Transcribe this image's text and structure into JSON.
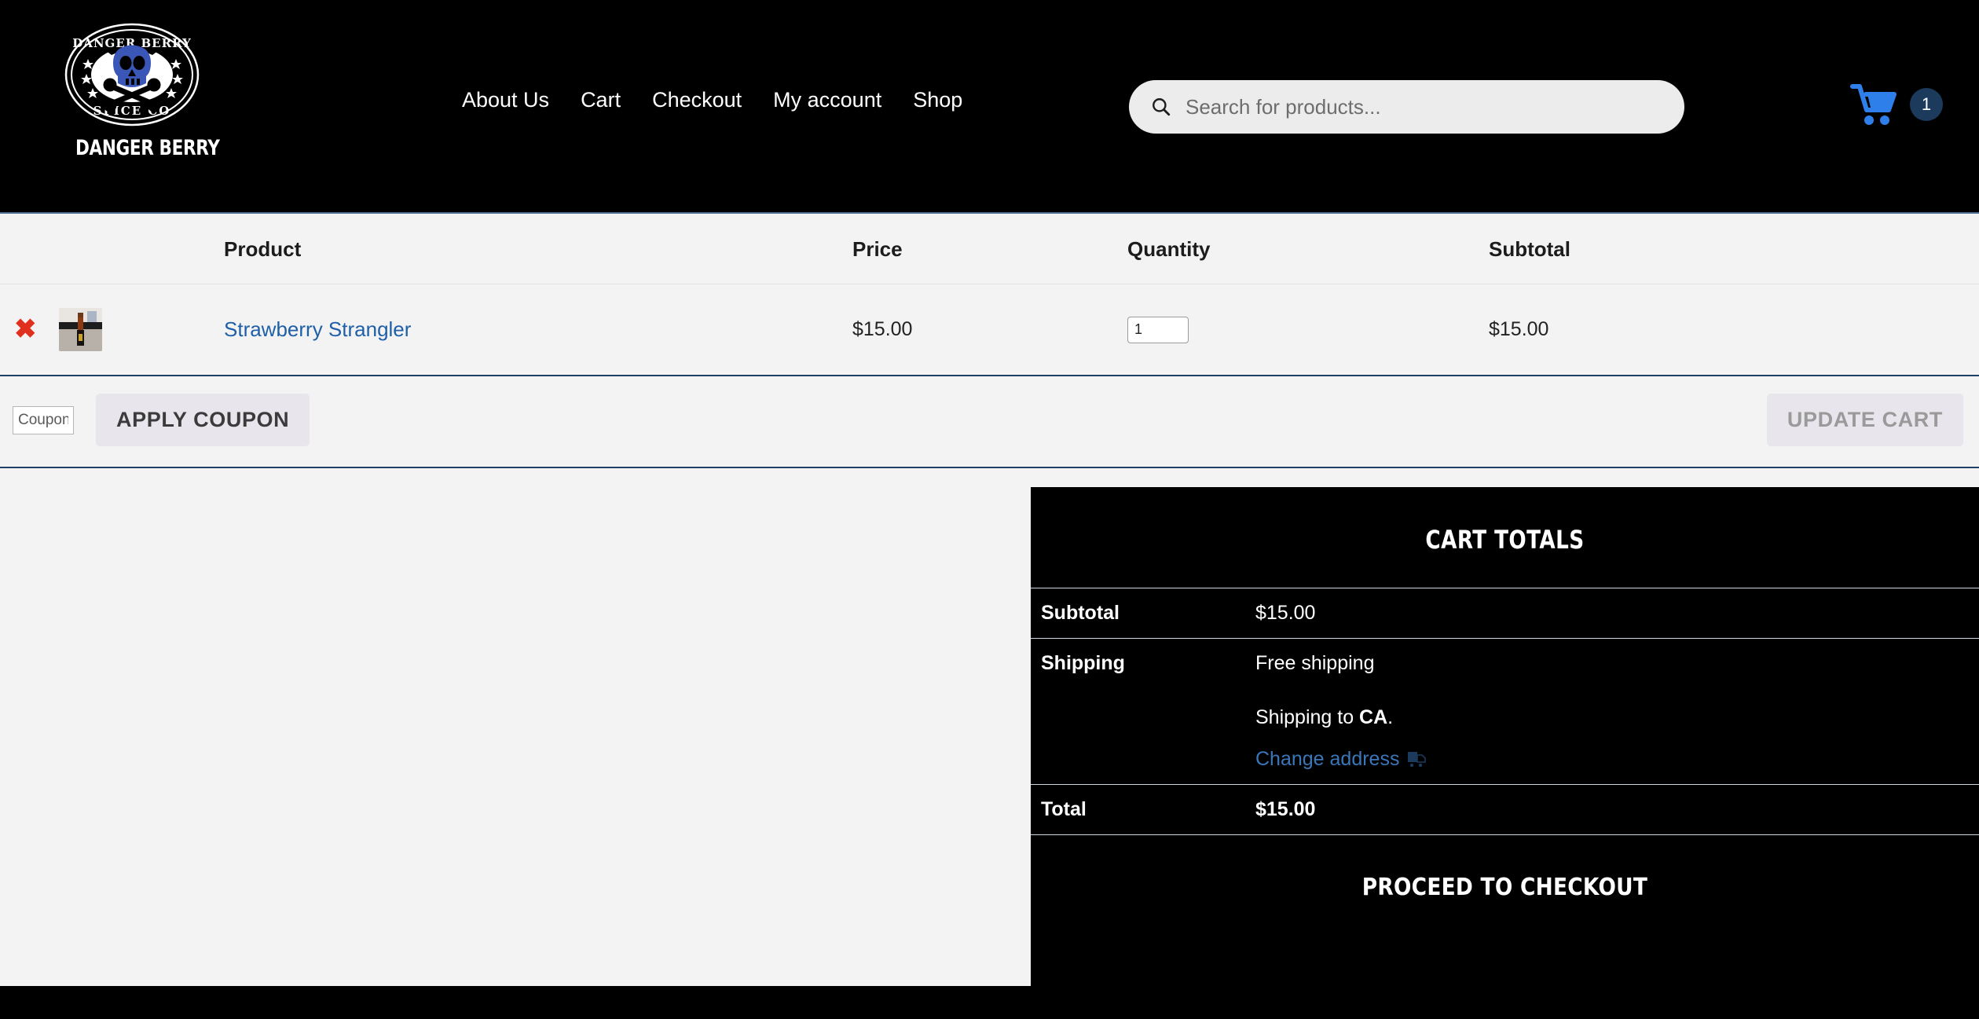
{
  "header": {
    "logo": {
      "top_text": "DANGER BERRY",
      "bottom_text": "SPICE CO",
      "icon": "skull-crossbones-icon"
    },
    "wordmark": "DANGER BERRY",
    "nav": [
      {
        "label": "About Us"
      },
      {
        "label": "Cart"
      },
      {
        "label": "Checkout"
      },
      {
        "label": "My account"
      },
      {
        "label": "Shop"
      }
    ],
    "search": {
      "icon": "search-icon",
      "placeholder": "Search for products...",
      "value": ""
    },
    "cart": {
      "icon": "shopping-cart-icon",
      "count": "1",
      "accent_color": "#2f7fea",
      "badge_color": "#1b3a5c"
    }
  },
  "cart_table": {
    "columns": {
      "product": "Product",
      "price": "Price",
      "quantity": "Quantity",
      "subtotal": "Subtotal"
    },
    "rows": [
      {
        "remove_label": "✖",
        "name": "Strawberry Strangler",
        "price": "$15.00",
        "quantity": "1",
        "subtotal": "$15.00"
      }
    ],
    "coupon_placeholder": "Coupon code",
    "coupon_value": "",
    "apply_coupon_label": "APPLY COUPON",
    "update_cart_label": "UPDATE CART"
  },
  "cart_totals": {
    "heading": "CART TOTALS",
    "subtotal_label": "Subtotal",
    "subtotal_value": "$15.00",
    "shipping_label": "Shipping",
    "shipping_method": "Free shipping",
    "shipping_to_prefix": "Shipping to ",
    "shipping_to_state": "CA",
    "shipping_to_suffix": ".",
    "change_address_label": "Change address",
    "truck_icon": "delivery-truck-icon",
    "total_label": "Total",
    "total_value": "$15.00",
    "checkout_label": "PROCEED TO CHECKOUT"
  }
}
